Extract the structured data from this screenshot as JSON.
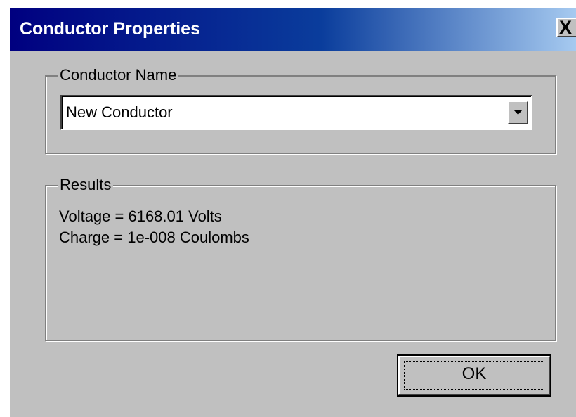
{
  "window": {
    "title": "Conductor Properties",
    "close_label": "X"
  },
  "conductor_name": {
    "legend": "Conductor Name",
    "selected_value": "New Conductor"
  },
  "results": {
    "legend": "Results",
    "voltage_text": "Voltage = 6168.01 Volts",
    "charge_text": "Charge = 1e-008 Coulombs"
  },
  "buttons": {
    "ok_label": "OK"
  },
  "colors": {
    "dialog_face": "#c0c0c0",
    "titlebar_start": "#000080",
    "titlebar_end": "#a6caf0"
  },
  "icons": {
    "close": "close-icon",
    "dropdown": "chevron-down-icon"
  }
}
